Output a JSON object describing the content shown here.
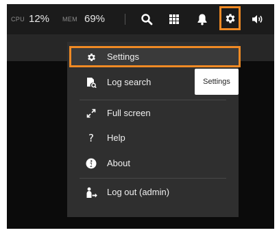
{
  "topbar": {
    "cpu_label": "CPU",
    "cpu_value": "12%",
    "mem_label": "MEM",
    "mem_value": "69%",
    "icons": [
      "search-icon",
      "grid-icon",
      "bell-icon",
      "gear-icon",
      "speaker-icon"
    ]
  },
  "menu": {
    "items": [
      {
        "label": "Settings",
        "icon": "gear-icon"
      },
      {
        "label": "Log search",
        "icon": "log-search-icon"
      },
      {
        "label": "Full screen",
        "icon": "expand-icon"
      },
      {
        "label": "Help",
        "icon": "question-icon"
      },
      {
        "label": "About",
        "icon": "info-icon"
      },
      {
        "label": "Log out (admin)",
        "icon": "logout-icon"
      }
    ]
  },
  "tooltip": {
    "text": "Settings"
  },
  "colors": {
    "highlight": "#f08a24",
    "menu_bg": "#2f2f2f",
    "topbar_bg": "#1b1b1b"
  }
}
